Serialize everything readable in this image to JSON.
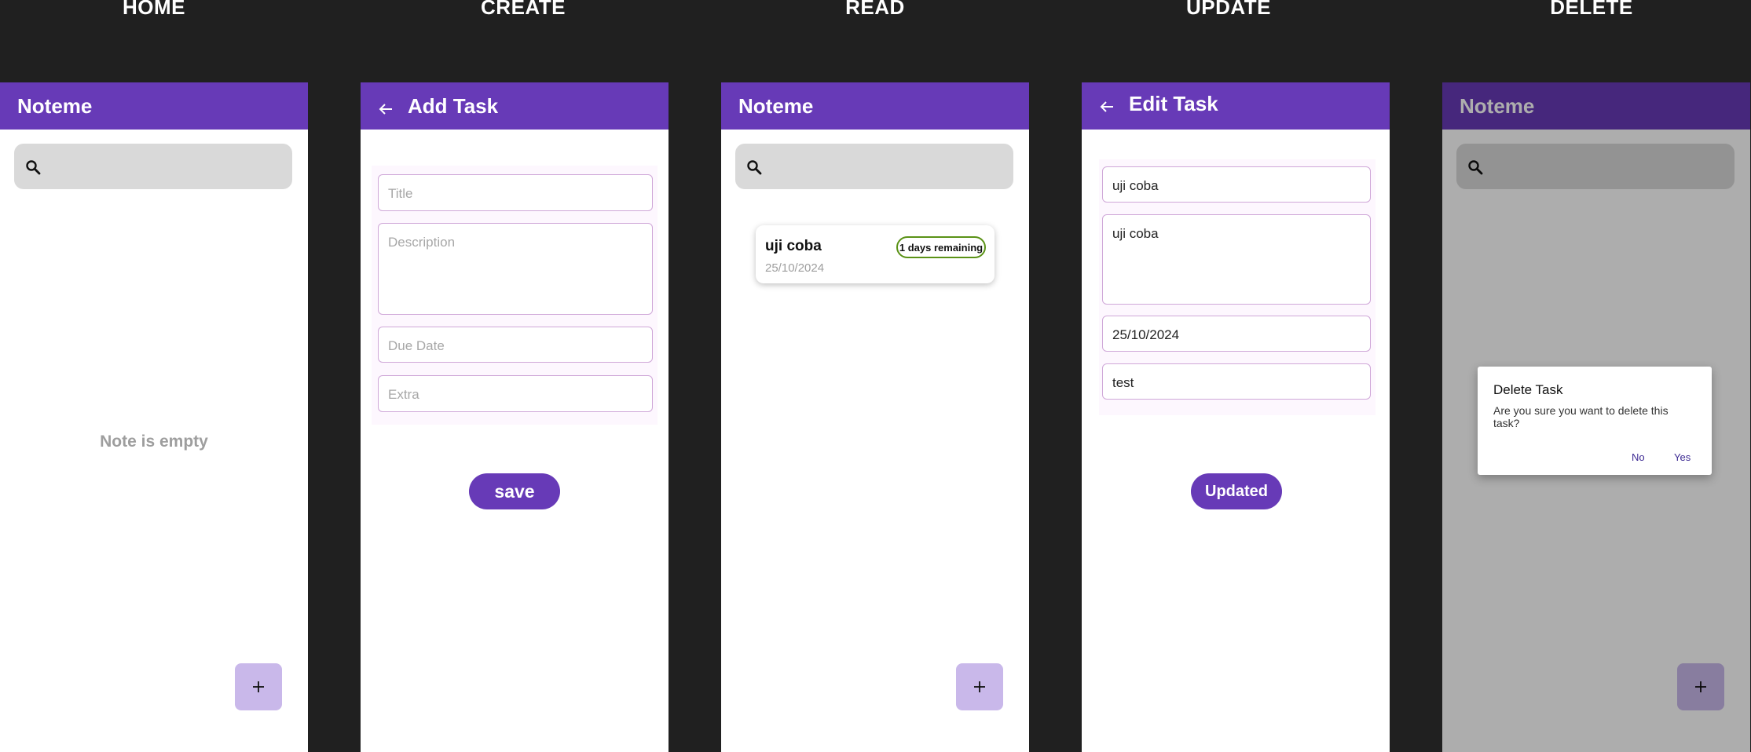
{
  "colors": {
    "background": "#202020",
    "appbar": "#673ab7",
    "fab": "#c9b8ea",
    "search": "#d9d9d9",
    "badge_border": "#5a9216"
  },
  "sections": [
    "HOME",
    "CREATE",
    "READ",
    "UPDATE",
    "DELETE"
  ],
  "home": {
    "title": "Noteme",
    "empty_text": "Note is empty",
    "fab_icon": "plus-icon",
    "search_icon": "search-icon"
  },
  "create": {
    "title": "Add Task",
    "back_icon": "back-arrow-icon",
    "placeholders": {
      "title": "Title",
      "description": "Description",
      "due_date": "Due Date",
      "extra": "Extra"
    },
    "button": "save"
  },
  "read": {
    "title": "Noteme",
    "card": {
      "title": "uji coba",
      "date": "25/10/2024",
      "badge": "1 days remaining"
    }
  },
  "update": {
    "title": "Edit Task",
    "values": {
      "title": "uji coba",
      "description": "uji coba",
      "due_date": "25/10/2024",
      "extra": "test"
    },
    "button": "Updated"
  },
  "delete": {
    "title": "Noteme",
    "dialog": {
      "title": "Delete Task",
      "message": "Are you sure you want to delete this task?",
      "no": "No",
      "yes": "Yes"
    }
  }
}
